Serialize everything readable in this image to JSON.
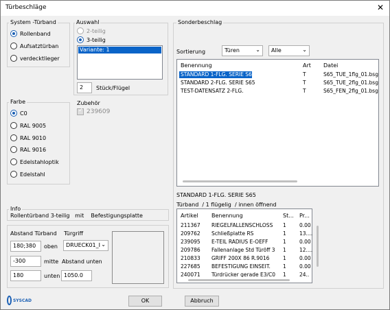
{
  "window": {
    "title": "Türbeschläge",
    "close_label": "✕"
  },
  "system": {
    "label": "System -Türband",
    "options": [
      {
        "label": "Rollenband",
        "selected": true
      },
      {
        "label": "Aufsatztürban",
        "selected": false
      },
      {
        "label": "verdecktlieger",
        "selected": false
      }
    ]
  },
  "auswahl": {
    "label": "Auswahl",
    "options": [
      {
        "label": "2-teilig",
        "selected": false,
        "disabled": true
      },
      {
        "label": "3-teilig",
        "selected": true,
        "disabled": false
      }
    ],
    "list_item": "Variante: 1",
    "count_value": "2",
    "count_label": "Stück/Flügel"
  },
  "zubehoer": {
    "label": "Zubehör",
    "value": "239609"
  },
  "farbe": {
    "label": "Farbe",
    "options": [
      {
        "label": "C0",
        "selected": true
      },
      {
        "label": "RAL 9005",
        "selected": false
      },
      {
        "label": "RAL 9010",
        "selected": false
      },
      {
        "label": "RAL 9016",
        "selected": false
      },
      {
        "label": "Edelstahloptik",
        "selected": false
      },
      {
        "label": "Edelstahl",
        "selected": false
      }
    ]
  },
  "info": {
    "label": "Info",
    "text": "Rollentürband 3-teilig   mit    Befestigungsplatte"
  },
  "abstand": {
    "label": "Abstand Türband",
    "oben_value": "180;380",
    "oben_label": "oben",
    "mitte_value": "-300",
    "mitte_label": "mitte",
    "unten_value": "180",
    "unten_label": "unten",
    "tuergriff_label": "Türgriff",
    "tuergriff_value": "DRUECK01_I",
    "abstand_unten_label": "Abstand unten",
    "abstand_unten_value": "1050.0"
  },
  "sonder": {
    "label": "Sonderbeschlag",
    "sort_label": "Sortierung",
    "sort_value": "Türen",
    "filter_value": "Alle",
    "columns": [
      "Benennung",
      "Art",
      "Datei"
    ],
    "rows": [
      {
        "benennung": "STANDARD 1-FLG. SERIE S65",
        "art": "T",
        "datei": "S65_TUE_1flg_01.bsg",
        "selected": true
      },
      {
        "benennung": "STANDARD 2-FLG. SERIE S65",
        "art": "T",
        "datei": "S65_TUE_2flg_01.bsg",
        "selected": false
      },
      {
        "benennung": "TEST-DATENSATZ 2-FLG.",
        "art": "T",
        "datei": "S65_FEN_2flg_01.bsg",
        "selected": false
      }
    ],
    "selected_title": "STANDARD 1-FLG. SERIE S65",
    "selected_desc": "Türband  / 1 flügelig  / innen öffnend"
  },
  "articles": {
    "columns": [
      "Artikel",
      "Benennung",
      "St...",
      "Pr..."
    ],
    "rows": [
      {
        "artikel": "211367",
        "benennung": "RIEGELFALLENSCHLOSS",
        "st": "1",
        "pr": "0.00"
      },
      {
        "artikel": "209762",
        "benennung": "Schließplatte RS",
        "st": "1",
        "pr": "13...."
      },
      {
        "artikel": "239095",
        "benennung": "E-TEIL RADIUS E-OEFF",
        "st": "1",
        "pr": "0.00"
      },
      {
        "artikel": "209786",
        "benennung": "Fallenanlage Std Türöff 3",
        "st": "1",
        "pr": "12...."
      },
      {
        "artikel": "210833",
        "benennung": "GRIFF 200X 86 R.9016",
        "st": "1",
        "pr": "0.00"
      },
      {
        "artikel": "227685",
        "benennung": "BEFESTIGUNG EINSEIT.",
        "st": "1",
        "pr": "0.00"
      },
      {
        "artikel": "240071",
        "benennung": "Türdrücker gerade E3/C0",
        "st": "1",
        "pr": "24..."
      }
    ]
  },
  "footer": {
    "ok_label": "OK",
    "cancel_label": "Abbruch",
    "logo_text": "SYSCAD"
  },
  "colors": {
    "accent": "#0a64c8",
    "window_bg": "#f0f0f0"
  }
}
